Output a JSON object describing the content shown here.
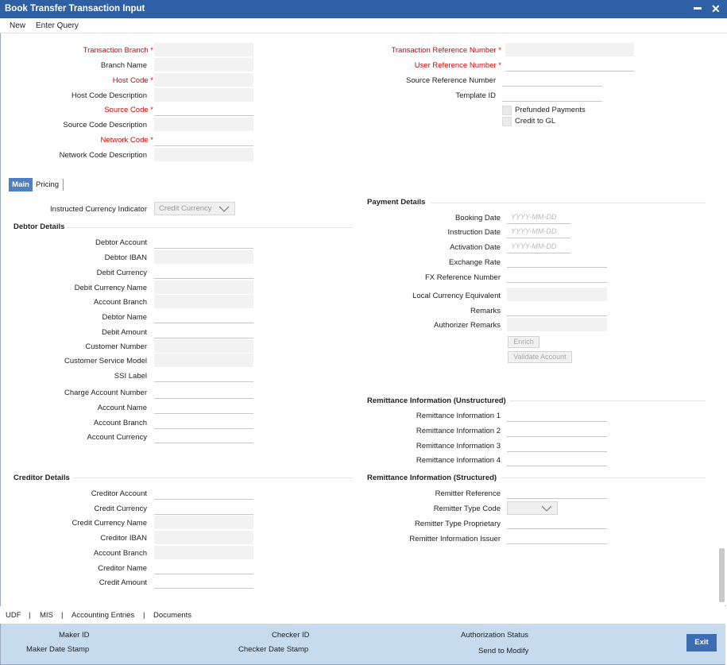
{
  "window": {
    "title": "Book Transfer Transaction Input",
    "minimize": "▬",
    "close": "✕"
  },
  "menu": {
    "new": "New",
    "enter_query": "Enter Query"
  },
  "header_left": [
    {
      "label": "Transaction Branch",
      "required": true,
      "mark": "*"
    },
    {
      "label": "Branch Name"
    },
    {
      "label": "Host Code",
      "required": true,
      "mark": "*"
    },
    {
      "label": "Host Code Description"
    },
    {
      "label": "Source Code",
      "required": true,
      "mark": "*"
    },
    {
      "label": "Source Code Description"
    },
    {
      "label": "Network Code",
      "required": true,
      "mark": "*"
    },
    {
      "label": "Network Code Description"
    }
  ],
  "header_right": [
    {
      "label": "Transaction Reference Number",
      "required": true,
      "mark": "*"
    },
    {
      "label": "User Reference Number",
      "required": true,
      "mark": "*"
    },
    {
      "label": "Source Reference Number"
    },
    {
      "label": "Template ID"
    }
  ],
  "checkboxes": {
    "prefunded": "Prefunded Payments",
    "credit_gl": "Credit to GL"
  },
  "tabs": {
    "main": "Main",
    "pricing": "Pricing"
  },
  "instructed_currency": {
    "label": "Instructed Currency Indicator",
    "value": "Credit Currency"
  },
  "debtor": {
    "title": "Debtor Details",
    "fields": [
      "Debtor Account",
      "Debtor IBAN",
      "Debit Currency",
      "Debit Currency Name",
      "Account Branch",
      "Debtor Name",
      "Debit Amount",
      "Customer Number",
      "Customer Service Model",
      "SSI Label",
      "Charge Account Number",
      "Account Name",
      "Account Branch",
      "Account Currency"
    ]
  },
  "payment": {
    "title": "Payment Details",
    "booking_date": "Booking Date",
    "instruction_date": "Instruction Date",
    "activation_date": "Activation Date",
    "date_placeholder": "YYYY-MM-DD",
    "exchange_rate": "Exchange Rate",
    "fx_ref": "FX Reference Number",
    "lce": "Local Currency Equivalent",
    "remarks": "Remarks",
    "auth_remarks": "Authorizer Remarks",
    "enrich": "Enrich",
    "validate": "Validate Account"
  },
  "remit_unstructured": {
    "title": "Remittance Information (Unstructured)",
    "fields": [
      "Remittance Information 1",
      "Remittance Information 2",
      "Remittance Information 3",
      "Remittance Information 4"
    ]
  },
  "creditor": {
    "title": "Creditor Details",
    "fields": [
      "Creditor Account",
      "Credit Currency",
      "Credit Currency Name",
      "Creditor IBAN",
      "Account Branch",
      "Creditor Name",
      "Credit Amount"
    ]
  },
  "remit_structured": {
    "title": "Remittance Information (Structured)",
    "remitter_ref": "Remitter Reference",
    "remitter_type": "Remitter Type Code",
    "remitter_prop": "Remitter Type Proprietary",
    "remitter_issuer": "Remitter Information Issuer"
  },
  "bottom_links": {
    "udf": "UDF",
    "mis": "MIS",
    "acc": "Accounting Entries",
    "docs": "Documents",
    "sep": "|"
  },
  "audit": {
    "maker_id": "Maker ID",
    "maker_date": "Maker Date Stamp",
    "checker_id": "Checker ID",
    "checker_date": "Checker Date Stamp",
    "auth_status": "Authorization Status",
    "send_modify": "Send to Modify",
    "exit": "Exit"
  }
}
